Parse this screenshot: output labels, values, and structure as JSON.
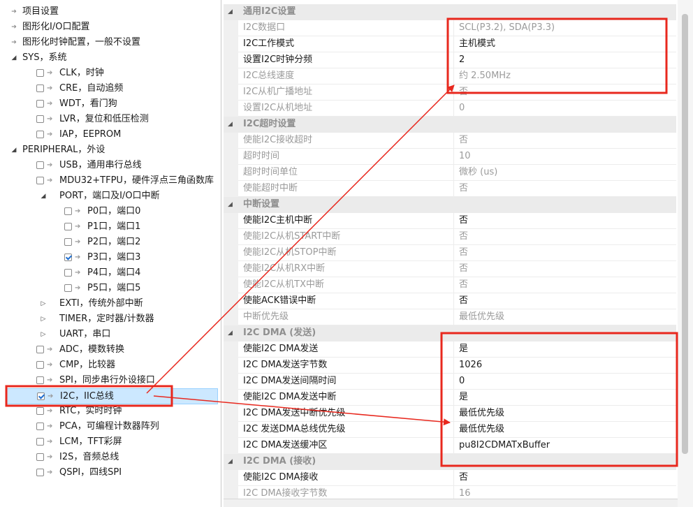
{
  "tree": {
    "items": [
      {
        "label": "项目设置",
        "level": 0,
        "expander": "leaf",
        "check": null
      },
      {
        "label": "图形化I/O口配置",
        "level": 0,
        "expander": "leaf",
        "check": null
      },
      {
        "label": "图形化时钟配置，一般不设置",
        "level": 0,
        "expander": "leaf",
        "check": null
      },
      {
        "label": "SYS，系统",
        "level": 0,
        "expander": "open",
        "check": null
      },
      {
        "label": "CLK，时钟",
        "level": 1,
        "expander": "none",
        "check": false
      },
      {
        "label": "CRE，自动追频",
        "level": 1,
        "expander": "none",
        "check": false
      },
      {
        "label": "WDT，看门狗",
        "level": 1,
        "expander": "none",
        "check": false
      },
      {
        "label": "LVR，复位和低压检测",
        "level": 1,
        "expander": "none",
        "check": false
      },
      {
        "label": "IAP，EEPROM",
        "level": 1,
        "expander": "none",
        "check": false
      },
      {
        "label": "PERIPHERAL，外设",
        "level": 0,
        "expander": "open",
        "check": null
      },
      {
        "label": "USB，通用串行总线",
        "level": 1,
        "expander": "none",
        "check": false
      },
      {
        "label": "MDU32+TFPU，硬件浮点三角函数库",
        "level": 1,
        "expander": "none",
        "check": false
      },
      {
        "label": "PORT，端口及I/O口中断",
        "level": 1,
        "expander": "open",
        "check": null
      },
      {
        "label": "P0口，端口0",
        "level": 2,
        "expander": "none",
        "check": false
      },
      {
        "label": "P1口，端口1",
        "level": 2,
        "expander": "none",
        "check": false
      },
      {
        "label": "P2口，端口2",
        "level": 2,
        "expander": "none",
        "check": false
      },
      {
        "label": "P3口，端口3",
        "level": 2,
        "expander": "none",
        "check": true
      },
      {
        "label": "P4口，端口4",
        "level": 2,
        "expander": "none",
        "check": false
      },
      {
        "label": "P5口，端口5",
        "level": 2,
        "expander": "none",
        "check": false
      },
      {
        "label": "EXTI，传统外部中断",
        "level": 1,
        "expander": "closed",
        "check": null
      },
      {
        "label": "TIMER，定时器/计数器",
        "level": 1,
        "expander": "closed",
        "check": null
      },
      {
        "label": "UART，串口",
        "level": 1,
        "expander": "closed",
        "check": null
      },
      {
        "label": "ADC，模数转换",
        "level": 1,
        "expander": "none",
        "check": false
      },
      {
        "label": "CMP，比较器",
        "level": 1,
        "expander": "none",
        "check": false
      },
      {
        "label": "SPI，同步串行外设接口",
        "level": 1,
        "expander": "none",
        "check": false
      },
      {
        "label": "I2C，IIC总线",
        "level": 1,
        "expander": "none",
        "check": true,
        "selected": true
      },
      {
        "label": "RTC，实时时钟",
        "level": 1,
        "expander": "none",
        "check": false
      },
      {
        "label": "PCA，可编程计数器阵列",
        "level": 1,
        "expander": "none",
        "check": false
      },
      {
        "label": "LCM，TFT彩屏",
        "level": 1,
        "expander": "none",
        "check": false
      },
      {
        "label": "I2S，音频总线",
        "level": 1,
        "expander": "none",
        "check": false
      },
      {
        "label": "QSPI，四线SPI",
        "level": 1,
        "expander": "none",
        "check": false
      }
    ]
  },
  "grid": {
    "rows": [
      {
        "type": "cat",
        "title": "通用I2C设置"
      },
      {
        "type": "prop",
        "name": "I2C数据口",
        "value": "SCL(P3.2), SDA(P3.3)",
        "enabled": false
      },
      {
        "type": "prop",
        "name": "I2C工作模式",
        "value": "主机模式",
        "enabled": true
      },
      {
        "type": "prop",
        "name": "设置I2C时钟分频",
        "value": "2",
        "enabled": true
      },
      {
        "type": "prop",
        "name": "I2C总线速度",
        "value": "约 2.50MHz",
        "enabled": false
      },
      {
        "type": "prop",
        "name": "I2C从机广播地址",
        "value": "否",
        "enabled": false
      },
      {
        "type": "prop",
        "name": "设置I2C从机地址",
        "value": "0",
        "enabled": false
      },
      {
        "type": "cat",
        "title": "I2C超时设置"
      },
      {
        "type": "prop",
        "name": "使能I2C接收超时",
        "value": "否",
        "enabled": false
      },
      {
        "type": "prop",
        "name": "超时时间",
        "value": "10",
        "enabled": false
      },
      {
        "type": "prop",
        "name": "超时时间单位",
        "value": "微秒 (us)",
        "enabled": false
      },
      {
        "type": "prop",
        "name": "使能超时中断",
        "value": "否",
        "enabled": false
      },
      {
        "type": "cat",
        "title": "中断设置"
      },
      {
        "type": "prop",
        "name": "使能I2C主机中断",
        "value": "否",
        "enabled": true
      },
      {
        "type": "prop",
        "name": "使能I2C从机START中断",
        "value": "否",
        "enabled": false
      },
      {
        "type": "prop",
        "name": "使能I2C从机STOP中断",
        "value": "否",
        "enabled": false
      },
      {
        "type": "prop",
        "name": "使能I2C从机RX中断",
        "value": "否",
        "enabled": false
      },
      {
        "type": "prop",
        "name": "使能I2C从机TX中断",
        "value": "否",
        "enabled": false
      },
      {
        "type": "prop",
        "name": "使能ACK错误中断",
        "value": "否",
        "enabled": true
      },
      {
        "type": "prop",
        "name": "中断优先级",
        "value": "最低优先级",
        "enabled": false
      },
      {
        "type": "cat",
        "title": "I2C DMA (发送)"
      },
      {
        "type": "prop",
        "name": "使能I2C DMA发送",
        "value": "是",
        "enabled": true
      },
      {
        "type": "prop",
        "name": "I2C DMA发送字节数",
        "value": "1026",
        "enabled": true
      },
      {
        "type": "prop",
        "name": "I2C DMA发送间隔时间",
        "value": "0",
        "enabled": true
      },
      {
        "type": "prop",
        "name": "使能I2C DMA发送中断",
        "value": "是",
        "enabled": true
      },
      {
        "type": "prop",
        "name": "I2C DMA发送中断优先级",
        "value": "最低优先级",
        "enabled": true
      },
      {
        "type": "prop",
        "name": "I2C 发送DMA总线优先级",
        "value": "最低优先级",
        "enabled": true
      },
      {
        "type": "prop",
        "name": "I2C DMA发送缓冲区",
        "value": "pu8I2CDMATxBuffer",
        "enabled": true
      },
      {
        "type": "cat",
        "title": "I2C DMA (接收)"
      },
      {
        "type": "prop",
        "name": "使能I2C DMA接收",
        "value": "否",
        "enabled": true
      },
      {
        "type": "prop",
        "name": "I2C DMA接收字节数",
        "value": "16",
        "enabled": false
      }
    ]
  },
  "annotation_color": "#e8281e"
}
